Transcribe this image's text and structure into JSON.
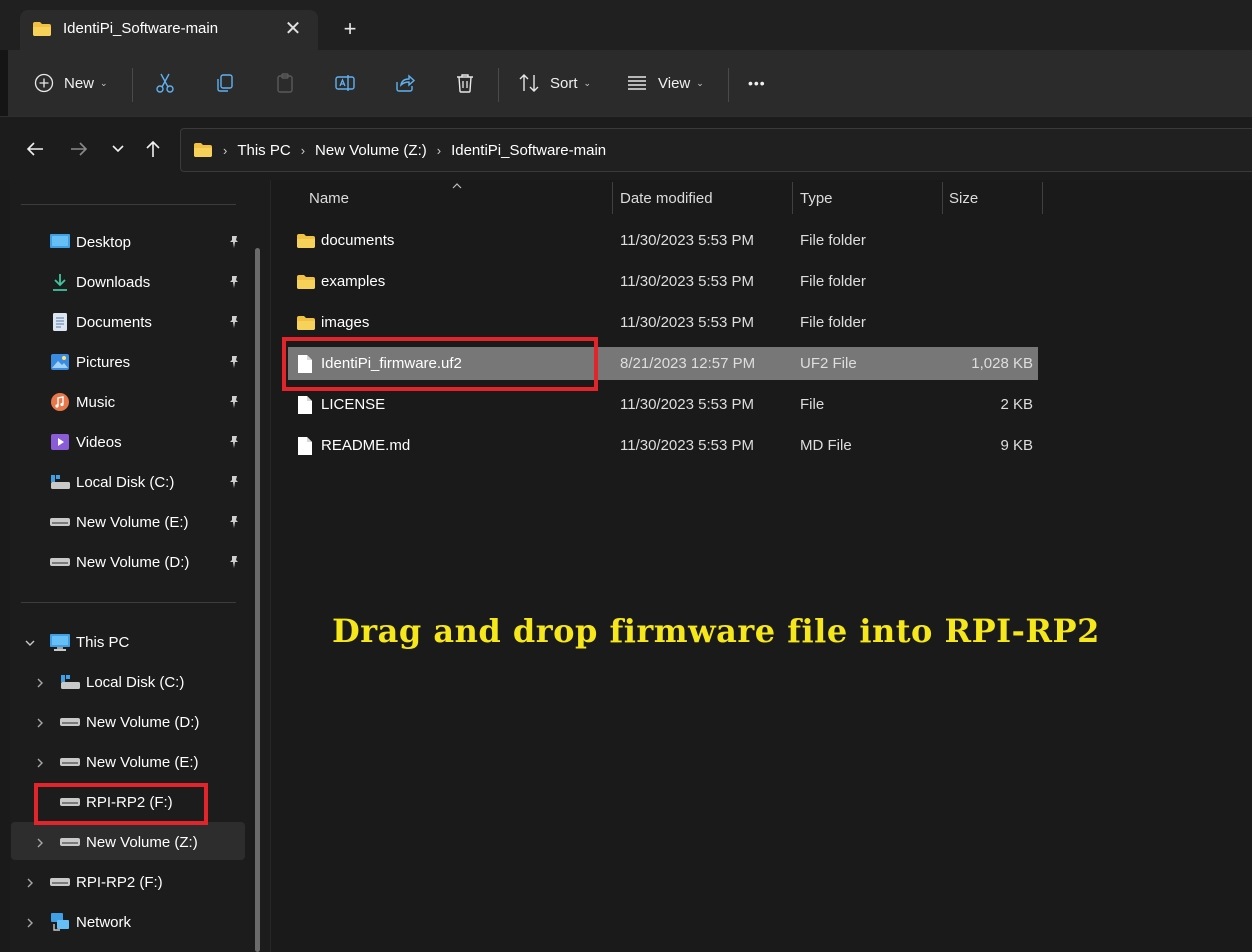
{
  "window": {
    "tab_title": "IdentiPi_Software-main",
    "close_glyph": "✕",
    "new_tab_glyph": "+"
  },
  "commandbar": {
    "new_label": "New",
    "sort_label": "Sort",
    "view_label": "View",
    "more_glyph": "•••",
    "chevron": "⌄"
  },
  "address": {
    "crumbs": [
      "This PC",
      "New Volume (Z:)",
      "IdentiPi_Software-main"
    ],
    "separator": "›"
  },
  "sidebar": {
    "quick_access": [
      {
        "label": "Desktop",
        "icon": "desktop-icon"
      },
      {
        "label": "Downloads",
        "icon": "download-icon"
      },
      {
        "label": "Documents",
        "icon": "documents-icon"
      },
      {
        "label": "Pictures",
        "icon": "pictures-icon"
      },
      {
        "label": "Music",
        "icon": "music-icon"
      },
      {
        "label": "Videos",
        "icon": "videos-icon"
      },
      {
        "label": "Local Disk (C:)",
        "icon": "system-drive-icon"
      },
      {
        "label": "New Volume (E:)",
        "icon": "drive-icon"
      },
      {
        "label": "New Volume (D:)",
        "icon": "drive-icon"
      }
    ],
    "this_pc": "This PC",
    "this_pc_children": [
      {
        "label": "Local Disk (C:)",
        "icon": "system-drive-icon"
      },
      {
        "label": "New Volume (D:)",
        "icon": "drive-icon"
      },
      {
        "label": "New Volume (E:)",
        "icon": "drive-icon"
      },
      {
        "label": "RPI-RP2 (F:)",
        "icon": "drive-icon"
      },
      {
        "label": "New Volume (Z:)",
        "icon": "drive-icon"
      }
    ],
    "rpi_drive": "RPI-RP2 (F:)",
    "network": "Network"
  },
  "filelist": {
    "columns": {
      "name": "Name",
      "date": "Date modified",
      "type": "Type",
      "size": "Size"
    },
    "rows": [
      {
        "name": "documents",
        "date": "11/30/2023 5:53 PM",
        "type": "File folder",
        "size": "",
        "icon": "folder-icon"
      },
      {
        "name": "examples",
        "date": "11/30/2023 5:53 PM",
        "type": "File folder",
        "size": "",
        "icon": "folder-icon"
      },
      {
        "name": "images",
        "date": "11/30/2023 5:53 PM",
        "type": "File folder",
        "size": "",
        "icon": "folder-icon"
      },
      {
        "name": "IdentiPi_firmware.uf2",
        "date": "8/21/2023 12:57 PM",
        "type": "UF2 File",
        "size": "1,028 KB",
        "icon": "file-icon"
      },
      {
        "name": "LICENSE",
        "date": "11/30/2023 5:53 PM",
        "type": "File",
        "size": "2 KB",
        "icon": "file-icon"
      },
      {
        "name": "README.md",
        "date": "11/30/2023 5:53 PM",
        "type": "MD File",
        "size": "9 KB",
        "icon": "file-icon"
      }
    ]
  },
  "annotation": {
    "instruction": "Drag and drop firmware file into RPI-RP2",
    "highlight_color": "#e3242b",
    "text_color": "#f5e71a"
  }
}
